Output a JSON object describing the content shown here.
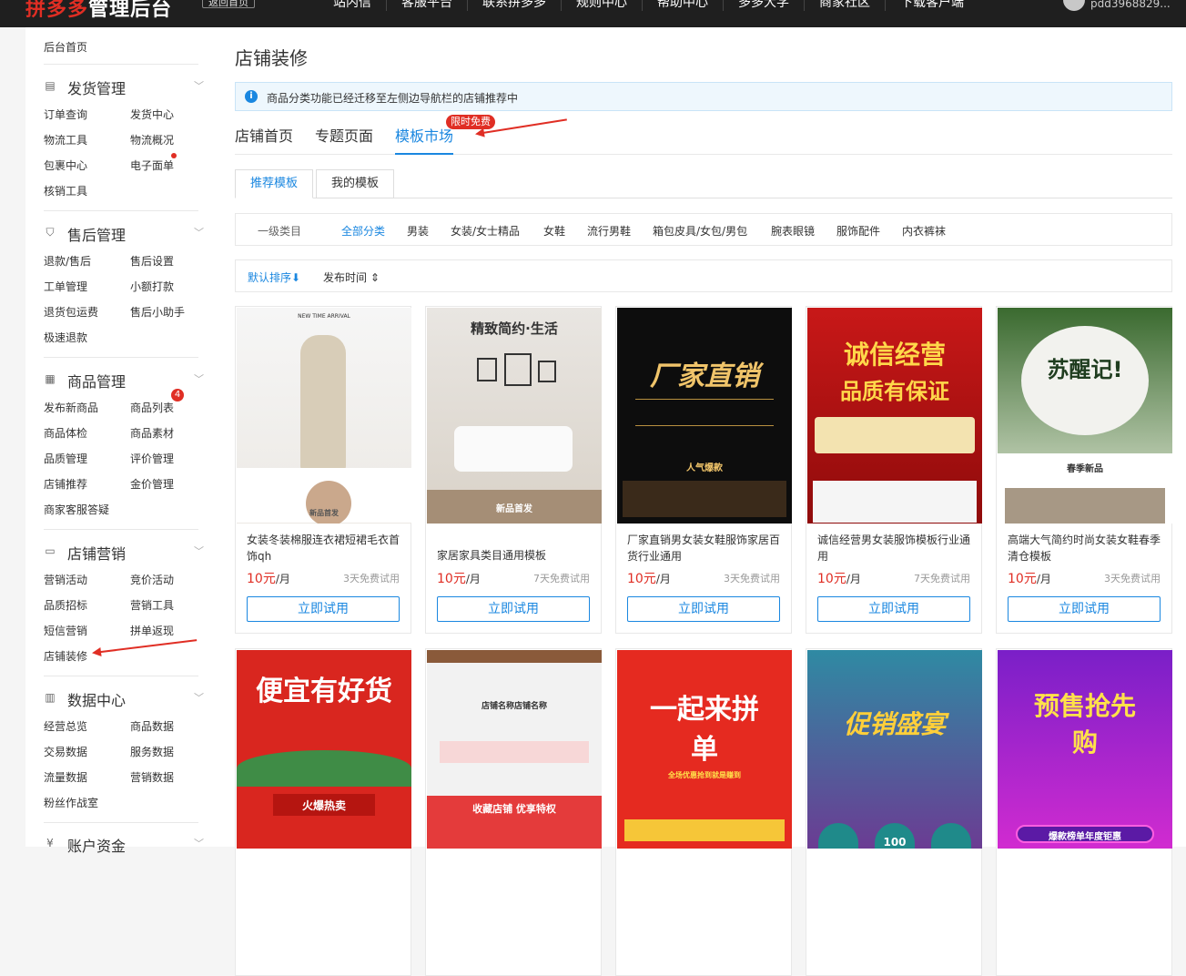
{
  "header": {
    "logo_red": "拼多多",
    "logo_white": "管理后台",
    "home_btn": "返回首页",
    "nav": [
      "站内信",
      "客服平台",
      "联系拼多多",
      "规则中心",
      "帮助中心",
      "多多大学",
      "商家社区",
      "下载客户端"
    ],
    "username": "pdd3968829..."
  },
  "sidebar": {
    "home": "后台首页",
    "sections": [
      {
        "title": "发货管理",
        "items": [
          "订单查询",
          "发货中心",
          "物流工具",
          "物流概况",
          "包裹中心",
          "电子面单",
          "核销工具"
        ]
      },
      {
        "title": "售后管理",
        "items": [
          "退款/售后",
          "售后设置",
          "工单管理",
          "小额打款",
          "退货包运费",
          "售后小助手",
          "极速退款"
        ]
      },
      {
        "title": "商品管理",
        "items": [
          "发布新商品",
          "商品列表",
          "商品体检",
          "商品素材",
          "品质管理",
          "评价管理",
          "店铺推荐",
          "金价管理",
          "商家客服答疑"
        ],
        "badge": "4"
      },
      {
        "title": "店铺营销",
        "items": [
          "营销活动",
          "竞价活动",
          "品质招标",
          "营销工具",
          "短信营销",
          "拼单返现",
          "店铺装修"
        ]
      },
      {
        "title": "数据中心",
        "items": [
          "经营总览",
          "商品数据",
          "交易数据",
          "服务数据",
          "流量数据",
          "营销数据",
          "粉丝作战室"
        ]
      },
      {
        "title": "账户资金",
        "items": []
      }
    ]
  },
  "main": {
    "title": "店铺装修",
    "notice": "商品分类功能已经迁移至左侧边导航栏的店铺推荐中",
    "tabs": [
      "店铺首页",
      "专题页面",
      "模板市场"
    ],
    "free_tag": "限时免费",
    "subtabs": [
      "推荐模板",
      "我的模板"
    ],
    "filter": {
      "label": "一级类目",
      "items": [
        "全部分类",
        "男装",
        "女装/女士精品",
        "女鞋",
        "流行男鞋",
        "箱包皮具/女包/男包",
        "腕表眼镜",
        "服饰配件",
        "内衣裤袜"
      ]
    },
    "sort": [
      "默认排序",
      "发布时间"
    ],
    "cards": [
      {
        "name": "女装冬装棉服连衣裙短裙毛衣首饰qh",
        "price": "10元",
        "unit": "/月",
        "trial": "3天免费试用",
        "btn": "立即试用",
        "thumb_text": [
          "NEW TIME ARRIVAL",
          "新品首发"
        ]
      },
      {
        "name": "家居家具类目通用模板",
        "price": "10元",
        "unit": "/月",
        "trial": "7天免费试用",
        "btn": "立即试用",
        "thumb_text": [
          "精致简约·生活",
          "新品首发"
        ]
      },
      {
        "name": "厂家直销男女装女鞋服饰家居百货行业通用",
        "price": "10元",
        "unit": "/月",
        "trial": "3天免费试用",
        "btn": "立即试用",
        "thumb_text": [
          "厂家直销",
          "人气爆款"
        ]
      },
      {
        "name": "诚信经营男女装服饰模板行业通用",
        "price": "10元",
        "unit": "/月",
        "trial": "7天免费试用",
        "btn": "立即试用",
        "thumb_text": [
          "诚信经营",
          "品质有保证"
        ]
      },
      {
        "name": "高端大气简约时尚女装女鞋春季清仓模板",
        "price": "10元",
        "unit": "/月",
        "trial": "3天免费试用",
        "btn": "立即试用",
        "thumb_text": [
          "苏醒记!",
          "春季新品"
        ]
      },
      {
        "name": "",
        "price": "",
        "unit": "",
        "trial": "",
        "btn": "",
        "thumb_text": [
          "便宜有好货",
          "火爆热卖"
        ]
      },
      {
        "name": "",
        "price": "",
        "unit": "",
        "trial": "",
        "btn": "",
        "thumb_text": [
          "店铺名称店铺名称",
          "收藏店铺 优享特权"
        ]
      },
      {
        "name": "",
        "price": "",
        "unit": "",
        "trial": "",
        "btn": "",
        "thumb_text": [
          "一起来拼单",
          "全场优惠抢到就是赚到"
        ]
      },
      {
        "name": "",
        "price": "",
        "unit": "",
        "trial": "",
        "btn": "",
        "thumb_text": [
          "促销盛宴",
          "100"
        ]
      },
      {
        "name": "",
        "price": "",
        "unit": "",
        "trial": "",
        "btn": "",
        "thumb_text": [
          "预售抢先购",
          "爆款榜单年度钜惠"
        ]
      }
    ]
  }
}
